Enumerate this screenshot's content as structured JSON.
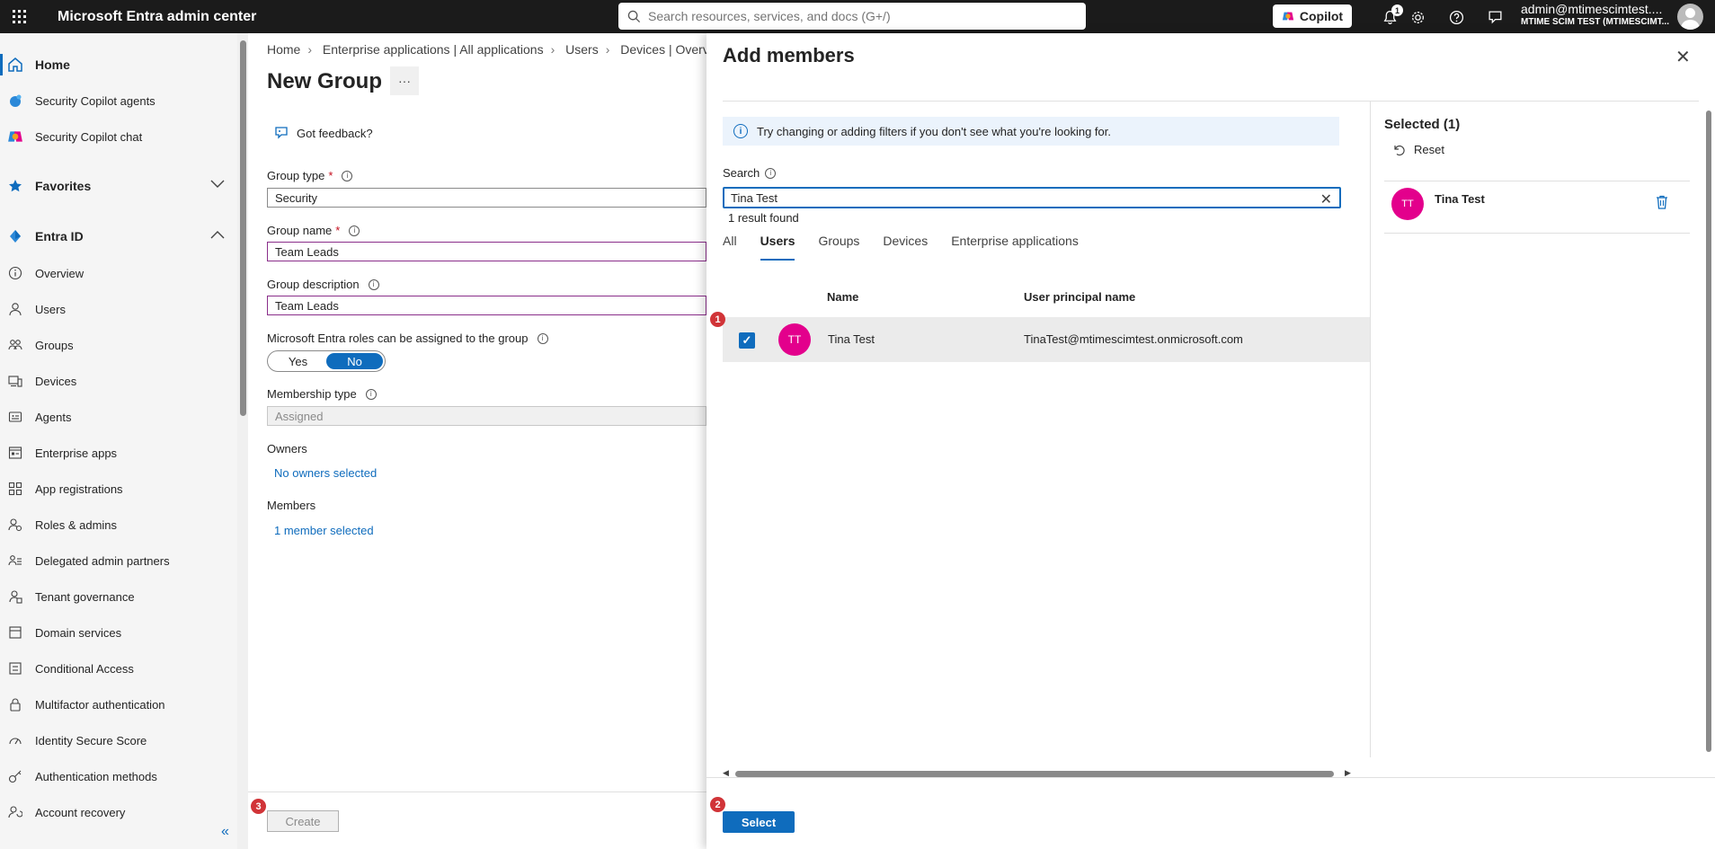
{
  "topbar": {
    "app_title": "Microsoft Entra admin center",
    "search_placeholder": "Search resources, services, and docs (G+/)",
    "copilot_label": "Copilot",
    "notification_count": "1",
    "account_name": "admin@mtimescimtest....",
    "account_tenant": "MTIME SCIM TEST (MTIMESCIMT..."
  },
  "sidebar": {
    "items": [
      {
        "label": "Home",
        "icon": "home-icon"
      },
      {
        "label": "Security Copilot agents",
        "icon": "copilot-agents-icon"
      },
      {
        "label": "Security Copilot chat",
        "icon": "copilot-chat-icon"
      },
      {
        "label": "Favorites",
        "icon": "star-icon"
      },
      {
        "label": "Entra ID",
        "icon": "entra-icon"
      },
      {
        "label": "Overview",
        "icon": "info-icon"
      },
      {
        "label": "Users",
        "icon": "user-icon"
      },
      {
        "label": "Groups",
        "icon": "groups-icon"
      },
      {
        "label": "Devices",
        "icon": "devices-icon"
      },
      {
        "label": "Agents",
        "icon": "agents-icon"
      },
      {
        "label": "Enterprise apps",
        "icon": "enterprise-apps-icon"
      },
      {
        "label": "App registrations",
        "icon": "app-registrations-icon"
      },
      {
        "label": "Roles & admins",
        "icon": "roles-icon"
      },
      {
        "label": "Delegated admin partners",
        "icon": "partners-icon"
      },
      {
        "label": "Tenant governance",
        "icon": "governance-icon"
      },
      {
        "label": "Domain services",
        "icon": "domain-icon"
      },
      {
        "label": "Conditional Access",
        "icon": "conditional-access-icon"
      },
      {
        "label": "Multifactor authentication",
        "icon": "mfa-icon"
      },
      {
        "label": "Identity Secure Score",
        "icon": "score-icon"
      },
      {
        "label": "Authentication methods",
        "icon": "auth-methods-icon"
      },
      {
        "label": "Account recovery",
        "icon": "recovery-icon"
      }
    ]
  },
  "main": {
    "breadcrumb": [
      "Home",
      "Enterprise applications | All applications",
      "Users",
      "Devices | Overvie"
    ],
    "title": "New Group",
    "more_label": "···",
    "feedback_label": "Got feedback?",
    "group_type_label": "Group type",
    "group_type_value": "Security",
    "group_name_label": "Group name",
    "group_name_value": "Team Leads",
    "group_desc_label": "Group description",
    "group_desc_value": "Team Leads",
    "roles_label": "Microsoft Entra roles can be assigned to the group",
    "toggle_yes": "Yes",
    "toggle_no": "No",
    "membership_label": "Membership type",
    "membership_value": "Assigned",
    "owners_label": "Owners",
    "owners_link": "No owners selected",
    "members_label": "Members",
    "members_link": "1 member selected",
    "create_label": "Create",
    "required_mark": "*"
  },
  "panel": {
    "title": "Add members",
    "info_text": "Try changing or adding filters if you don't see what you're looking for.",
    "search_label": "Search",
    "search_value": "Tina Test",
    "result_count": "1 result found",
    "tabs": [
      "All",
      "Users",
      "Groups",
      "Devices",
      "Enterprise applications"
    ],
    "selected_tab": "Users",
    "columns": {
      "name": "Name",
      "upn": "User principal name"
    },
    "row": {
      "initials": "TT",
      "name": "Tina Test",
      "upn": "TinaTest@mtimescimtest.onmicrosoft.com"
    },
    "selected_title": "Selected (1)",
    "reset_label": "Reset",
    "selected_item": {
      "initials": "TT",
      "name": "Tina Test"
    },
    "select_label": "Select"
  },
  "badges": {
    "b1": "1",
    "b2": "2",
    "b3": "3"
  },
  "colors": {
    "accent": "#0f6cbd",
    "avatar": "#e3008c",
    "badge": "#d13438",
    "topbar": "#1b1b1b"
  }
}
